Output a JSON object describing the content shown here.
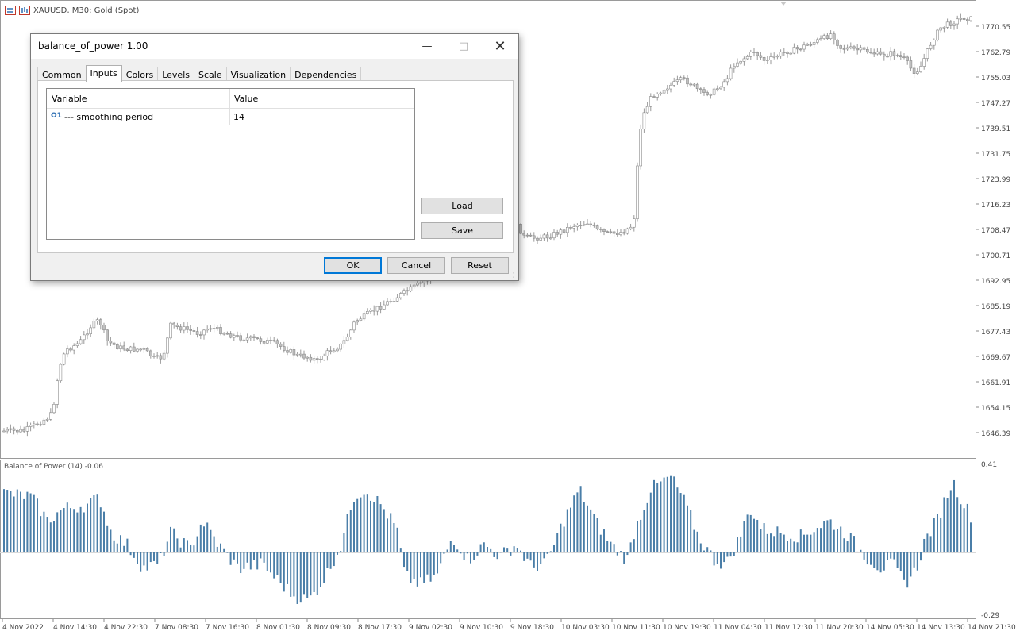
{
  "chart": {
    "symbol_title": "XAUUSD, M30:  Gold (Spot)",
    "price_labels": [
      "1770.55",
      "1762.79",
      "1755.03",
      "1747.27",
      "1739.51",
      "1731.75",
      "1723.99",
      "1716.23",
      "1708.47",
      "1700.71",
      "1692.95",
      "1685.19",
      "1677.43",
      "1669.67",
      "1661.91",
      "1654.15",
      "1646.39"
    ],
    "time_labels": [
      "4 Nov 2022",
      "4 Nov 14:30",
      "4 Nov 22:30",
      "7 Nov 08:30",
      "7 Nov 16:30",
      "8 Nov 01:30",
      "8 Nov 09:30",
      "8 Nov 17:30",
      "9 Nov 02:30",
      "9 Nov 10:30",
      "9 Nov 18:30",
      "10 Nov 03:30",
      "10 Nov 11:30",
      "10 Nov 19:30",
      "11 Nov 04:30",
      "11 Nov 12:30",
      "11 Nov 20:30",
      "14 Nov 05:30",
      "14 Nov 13:30",
      "14 Nov 21:30"
    ],
    "oscillator_label": "Balance of Power (14) -0.06",
    "oscillator_scale": [
      "0.41",
      "-0.29"
    ],
    "candle_color": "#c0c0c0",
    "oscillator_color": "#4a7ea8"
  },
  "dialog": {
    "title": "balance_of_power 1.00",
    "tabs": [
      "Common",
      "Inputs",
      "Colors",
      "Levels",
      "Scale",
      "Visualization",
      "Dependencies"
    ],
    "active_tab": "Inputs",
    "grid": {
      "col_variable": "Variable",
      "col_value": "Value",
      "rows": [
        {
          "icon": "O1",
          "name": "--- smoothing period",
          "value": "14"
        }
      ]
    },
    "load_label": "Load",
    "save_label": "Save",
    "ok_label": "OK",
    "cancel_label": "Cancel",
    "reset_label": "Reset"
  }
}
